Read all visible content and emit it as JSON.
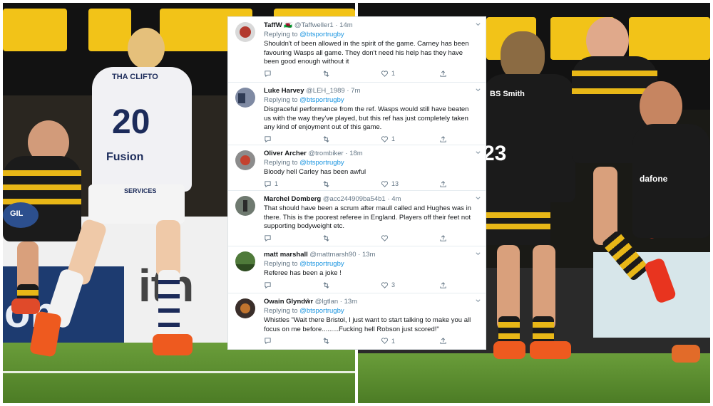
{
  "tweets": [
    {
      "name": "TaffW",
      "emoji": "🏴󠁧󠁢󠁷󠁬󠁳󠁿",
      "handle": "@Taffweller1",
      "sep": "·",
      "time": "14m",
      "reply_prefix": "Replying to",
      "reply_to": "@btsportrugby",
      "text": "Shouldn't of been allowed in the spirit of the game. Carney has been favouring Wasps all game. They don't need his help has they have been good enough without it",
      "replies": "",
      "retweets": "",
      "likes": "1"
    },
    {
      "name": "Luke Harvey",
      "emoji": "",
      "handle": "@LEH_1989",
      "sep": "·",
      "time": "7m",
      "reply_prefix": "Replying to",
      "reply_to": "@btsportrugby",
      "text": "Disgraceful performance from the ref. Wasps would still have beaten us with the way they've played, but this ref has just completely taken any kind of enjoyment out of this game.",
      "replies": "",
      "retweets": "",
      "likes": "1"
    },
    {
      "name": "Oliver Archer",
      "emoji": "",
      "handle": "@trombiker",
      "sep": "·",
      "time": "18m",
      "reply_prefix": "Replying to",
      "reply_to": "@btsportrugby",
      "text": "Bloody hell Carley has been awful",
      "replies": "1",
      "retweets": "",
      "likes": "13"
    },
    {
      "name": "Marchel Domberg",
      "emoji": "",
      "handle": "@acc244909ba54b1",
      "sep": "·",
      "time": "4m",
      "reply_prefix": "",
      "reply_to": "",
      "text": "That should have been a scrum after maull called and Hughes was in there. This is the poorest referee in England. Players off their feet not supporting bodyweight etc.",
      "replies": "",
      "retweets": "",
      "likes": ""
    },
    {
      "name": "matt marshall",
      "emoji": "",
      "handle": "@mattmarsh90",
      "sep": "·",
      "time": "13m",
      "reply_prefix": "Replying to",
      "reply_to": "@btsportrugby",
      "text": "Referee has been a joke !",
      "replies": "",
      "retweets": "",
      "likes": "3"
    },
    {
      "name": "Owain Glyndŵr",
      "emoji": "",
      "handle": "@lgtlan",
      "sep": "·",
      "time": "13m",
      "reply_prefix": "Replying to",
      "reply_to": "@btsportrugby",
      "text": "Whistles \"Wait there Bristol, I just want to start talking to make you all focus on me before.........Fucking hell Robson just scored!\"",
      "replies": "",
      "retweets": "",
      "likes": "1"
    }
  ],
  "photo_left": {
    "banner_text": "",
    "shirt_number": "20",
    "shirt_top": "THA CLIFTO",
    "shirt_sponsor": "Fusion",
    "shorts_text": "SERVICES",
    "ball_text": "GIL",
    "sign_text_1": "ith",
    "sign_text_2": "on"
  },
  "photo_right": {
    "sponsor_1": "BS Smith",
    "sponsor_2": "dafone",
    "shirt_number": "23"
  },
  "colors": {
    "wasps_yellow": "#f2c318",
    "twitter_blue": "#1b95e0",
    "bristol_navy": "#1c2b5a",
    "boot_orange": "#ee5a1f"
  }
}
